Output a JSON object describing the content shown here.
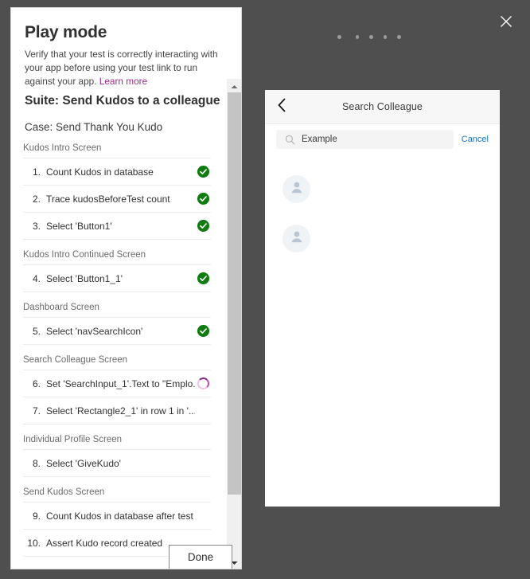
{
  "colors": {
    "backdrop": "#4f4f4f",
    "accent_link": "#a4268c",
    "pass_green": "#107c10",
    "running_magenta": "#8a2a82",
    "app_link_blue": "#1a73c8"
  },
  "panel": {
    "title": "Play mode",
    "description": "Verify that your test is correctly interacting with your app before using your test link to run against your app.",
    "learn_more_label": "Learn more",
    "suite_title": "Suite: Send Kudos to a colleague",
    "case_title": "Case: Send Thank You Kudo",
    "done_label": "Done",
    "scrollbar": {
      "up_arrow_icon": "chevron-up-icon",
      "down_arrow_icon": "chevron-down-icon"
    },
    "groups": [
      {
        "label": "Kudos Intro Screen",
        "steps": [
          {
            "num": "1.",
            "text": "Count Kudos in database",
            "status": "passed"
          },
          {
            "num": "2.",
            "text": "Trace kudosBeforeTest count",
            "status": "passed"
          },
          {
            "num": "3.",
            "text": "Select 'Button1'",
            "status": "passed"
          }
        ]
      },
      {
        "label": "Kudos Intro Continued Screen",
        "steps": [
          {
            "num": "4.",
            "text": "Select 'Button1_1'",
            "status": "passed"
          }
        ]
      },
      {
        "label": "Dashboard Screen",
        "steps": [
          {
            "num": "5.",
            "text": "Select 'navSearchIcon'",
            "status": "passed"
          }
        ]
      },
      {
        "label": "Search Colleague Screen",
        "steps": [
          {
            "num": "6.",
            "text": "Set 'SearchInput_1'.Text to \"Emplo...",
            "status": "running"
          },
          {
            "num": "7.",
            "text": "Select 'Rectangle2_1' in row 1 in '...",
            "status": "none"
          }
        ]
      },
      {
        "label": "Individual Profile Screen",
        "steps": [
          {
            "num": "8.",
            "text": "Select 'GiveKudo'",
            "status": "none"
          }
        ]
      },
      {
        "label": "Send Kudos Screen",
        "steps": [
          {
            "num": "9.",
            "text": "Count Kudos in database after test",
            "status": "none"
          },
          {
            "num": "10.",
            "text": "Assert Kudo record created",
            "status": "none"
          }
        ]
      }
    ]
  },
  "preview": {
    "close_icon": "close-icon",
    "loading_dots_count": 5,
    "app": {
      "back_icon": "chevron-left-icon",
      "header_title": "Search Colleague",
      "search": {
        "icon": "search-icon",
        "value": "Example",
        "cancel_label": "Cancel"
      },
      "results": [
        {
          "avatar_icon": "person-icon"
        },
        {
          "avatar_icon": "person-icon"
        }
      ]
    }
  }
}
